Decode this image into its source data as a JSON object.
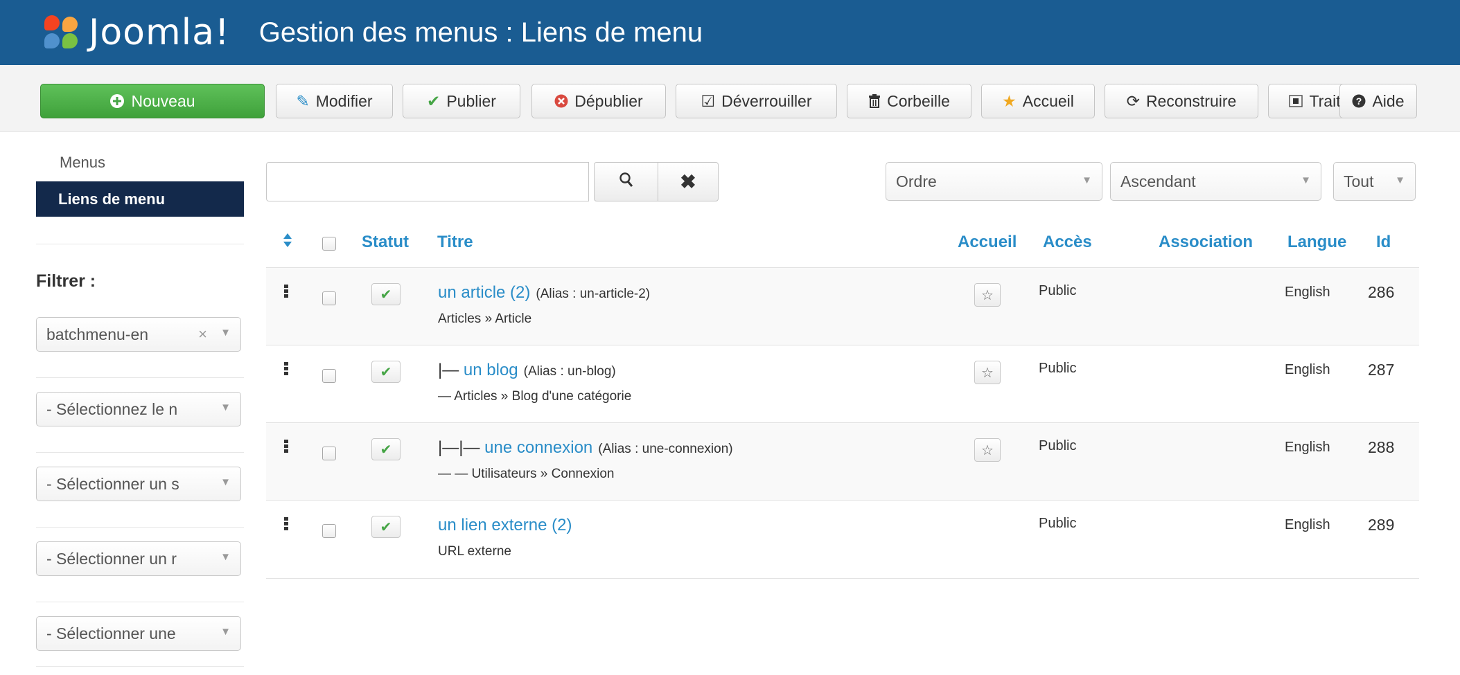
{
  "header": {
    "logo_text": "Joomla!",
    "title": "Gestion des menus : Liens de menu",
    "bg_color": "#1a5c92"
  },
  "toolbar": {
    "buttons": [
      {
        "label": "Nouveau",
        "icon": "plus-circle-icon"
      },
      {
        "label": "Modifier",
        "icon": "edit-icon"
      },
      {
        "label": "Publier",
        "icon": "check-icon"
      },
      {
        "label": "Dépublier",
        "icon": "x-circle-icon"
      },
      {
        "label": "Déverrouiller",
        "icon": "checkbox-icon"
      },
      {
        "label": "Corbeille",
        "icon": "trash-icon"
      },
      {
        "label": "Accueil",
        "icon": "star-icon"
      },
      {
        "label": "Reconstruire",
        "icon": "refresh-icon"
      },
      {
        "label": "Traitement",
        "icon": "batch-icon"
      },
      {
        "label": "Aide",
        "icon": "help-icon"
      }
    ]
  },
  "sidebar": {
    "items": [
      {
        "label": "Menus",
        "active": false
      },
      {
        "label": "Liens de menu",
        "active": true
      }
    ],
    "filter_label": "Filtrer :",
    "filters": [
      {
        "value": "batchmenu-en",
        "clearable": true
      },
      {
        "value": "- Sélectionnez le n"
      },
      {
        "value": "- Sélectionner un s"
      },
      {
        "value": "- Sélectionner un r"
      },
      {
        "value": "- Sélectionner une"
      }
    ]
  },
  "search": {
    "value": "",
    "placeholder": ""
  },
  "sorting": {
    "order_by": "Ordre",
    "direction": "Ascendant",
    "limit": "Tout"
  },
  "table": {
    "headers": {
      "status": "Statut",
      "title": "Titre",
      "home": "Accueil",
      "access": "Accès",
      "association": "Association",
      "language": "Langue",
      "id": "Id"
    },
    "rows": [
      {
        "prefix": "",
        "title": "un article (2)",
        "alias": "(Alias : un-article-2)",
        "type": "Articles » Article",
        "home": true,
        "access": "Public",
        "language": "English",
        "id": "286"
      },
      {
        "prefix": "|— ",
        "title": "un blog",
        "alias": "(Alias : un-blog)",
        "type": "— Articles » Blog d'une catégorie",
        "home": true,
        "access": "Public",
        "language": "English",
        "id": "287"
      },
      {
        "prefix": "|—|— ",
        "title": "une connexion",
        "alias": "(Alias : une-connexion)",
        "type": "— — Utilisateurs » Connexion",
        "home": true,
        "access": "Public",
        "language": "English",
        "id": "288"
      },
      {
        "prefix": "",
        "title": "un lien externe (2)",
        "alias": "",
        "type": "URL externe",
        "home": false,
        "access": "Public",
        "language": "English",
        "id": "289"
      }
    ]
  },
  "colors": {
    "accent": "#2a8dc8",
    "new_button": "#46a546",
    "sidebar_active": "#13294b"
  }
}
